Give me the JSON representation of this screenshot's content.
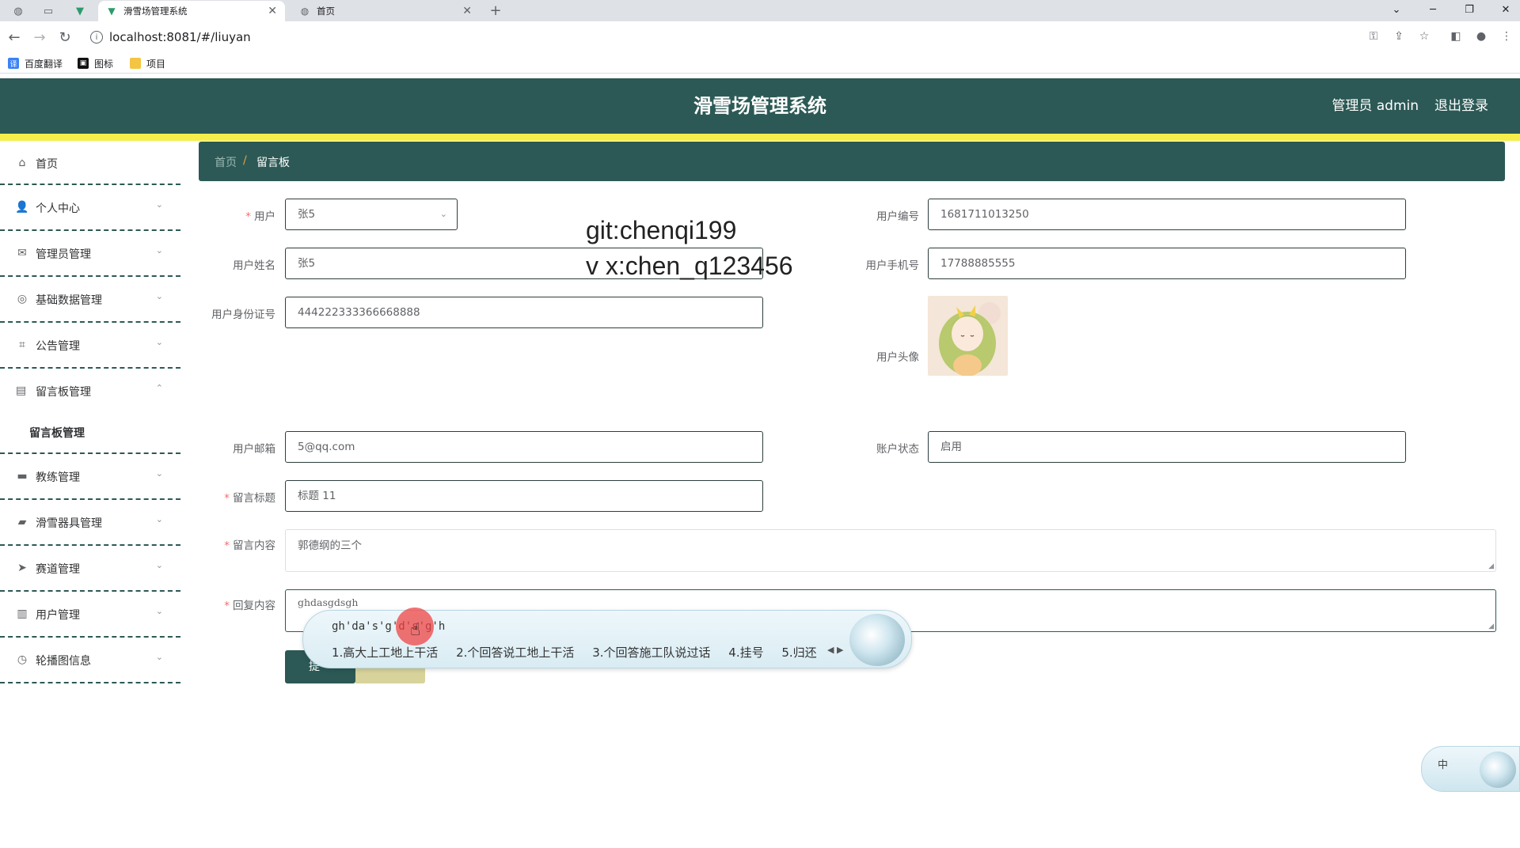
{
  "browser": {
    "tabs": [
      {
        "title": "滑雪场管理系统",
        "active": true
      },
      {
        "title": "首页",
        "active": false
      }
    ],
    "url": "localhost:8081/#/liuyan",
    "bookmarks": [
      "百度翻译",
      "图标",
      "项目"
    ]
  },
  "header": {
    "title": "滑雪场管理系统",
    "user": "管理员 admin",
    "logout": "退出登录"
  },
  "sidebar": {
    "items": [
      {
        "label": "首页",
        "icon": "home-icon"
      },
      {
        "label": "个人中心",
        "icon": "user-icon"
      },
      {
        "label": "管理员管理",
        "icon": "mail-icon"
      },
      {
        "label": "基础数据管理",
        "icon": "compass-icon"
      },
      {
        "label": "公告管理",
        "icon": "crop-icon"
      },
      {
        "label": "留言板管理",
        "icon": "cabinet-icon",
        "expanded": true
      },
      {
        "label": "教练管理",
        "icon": "film-icon"
      },
      {
        "label": "滑雪器具管理",
        "icon": "box-icon"
      },
      {
        "label": "赛道管理",
        "icon": "send-icon"
      },
      {
        "label": "用户管理",
        "icon": "document-icon"
      },
      {
        "label": "轮播图信息",
        "icon": "clock-icon"
      }
    ],
    "sub_item": "留言板管理"
  },
  "breadcrumb": {
    "home": "首页",
    "separator": "/",
    "current": "留言板"
  },
  "form": {
    "user_label": "用户",
    "user_value": "张5",
    "user_no_label": "用户编号",
    "user_no_value": "1681711013250",
    "name_label": "用户姓名",
    "name_value": "张5",
    "phone_label": "用户手机号",
    "phone_value": "17788885555",
    "id_label": "用户身份证号",
    "id_value": "444222333366668888",
    "avatar_label": "用户头像",
    "email_label": "用户邮箱",
    "email_value": "5@qq.com",
    "status_label": "账户状态",
    "status_value": "启用",
    "title_label": "留言标题",
    "title_value": "标题  11",
    "content_label": "留言内容",
    "content_value": "郭德纲的三个",
    "reply_label": "回复内容",
    "reply_value": "ghdasgdsgh",
    "submit_label": "提",
    "required_mark": "*"
  },
  "watermark": {
    "line1": "git:chenqi199",
    "line2": "v x:chen_q123456"
  },
  "ime": {
    "composition": "gh'da's'g'd's'g'h",
    "candidates": [
      "1.高大上工地上干活",
      "2.个回答说工地上干活",
      "3.个回答施工队说过话",
      "4.挂号",
      "5.归还"
    ],
    "float_label": "中"
  },
  "colors": {
    "primary": "#2c5955",
    "accent_strip": "#f4ed4a",
    "required": "#f56c6c"
  }
}
